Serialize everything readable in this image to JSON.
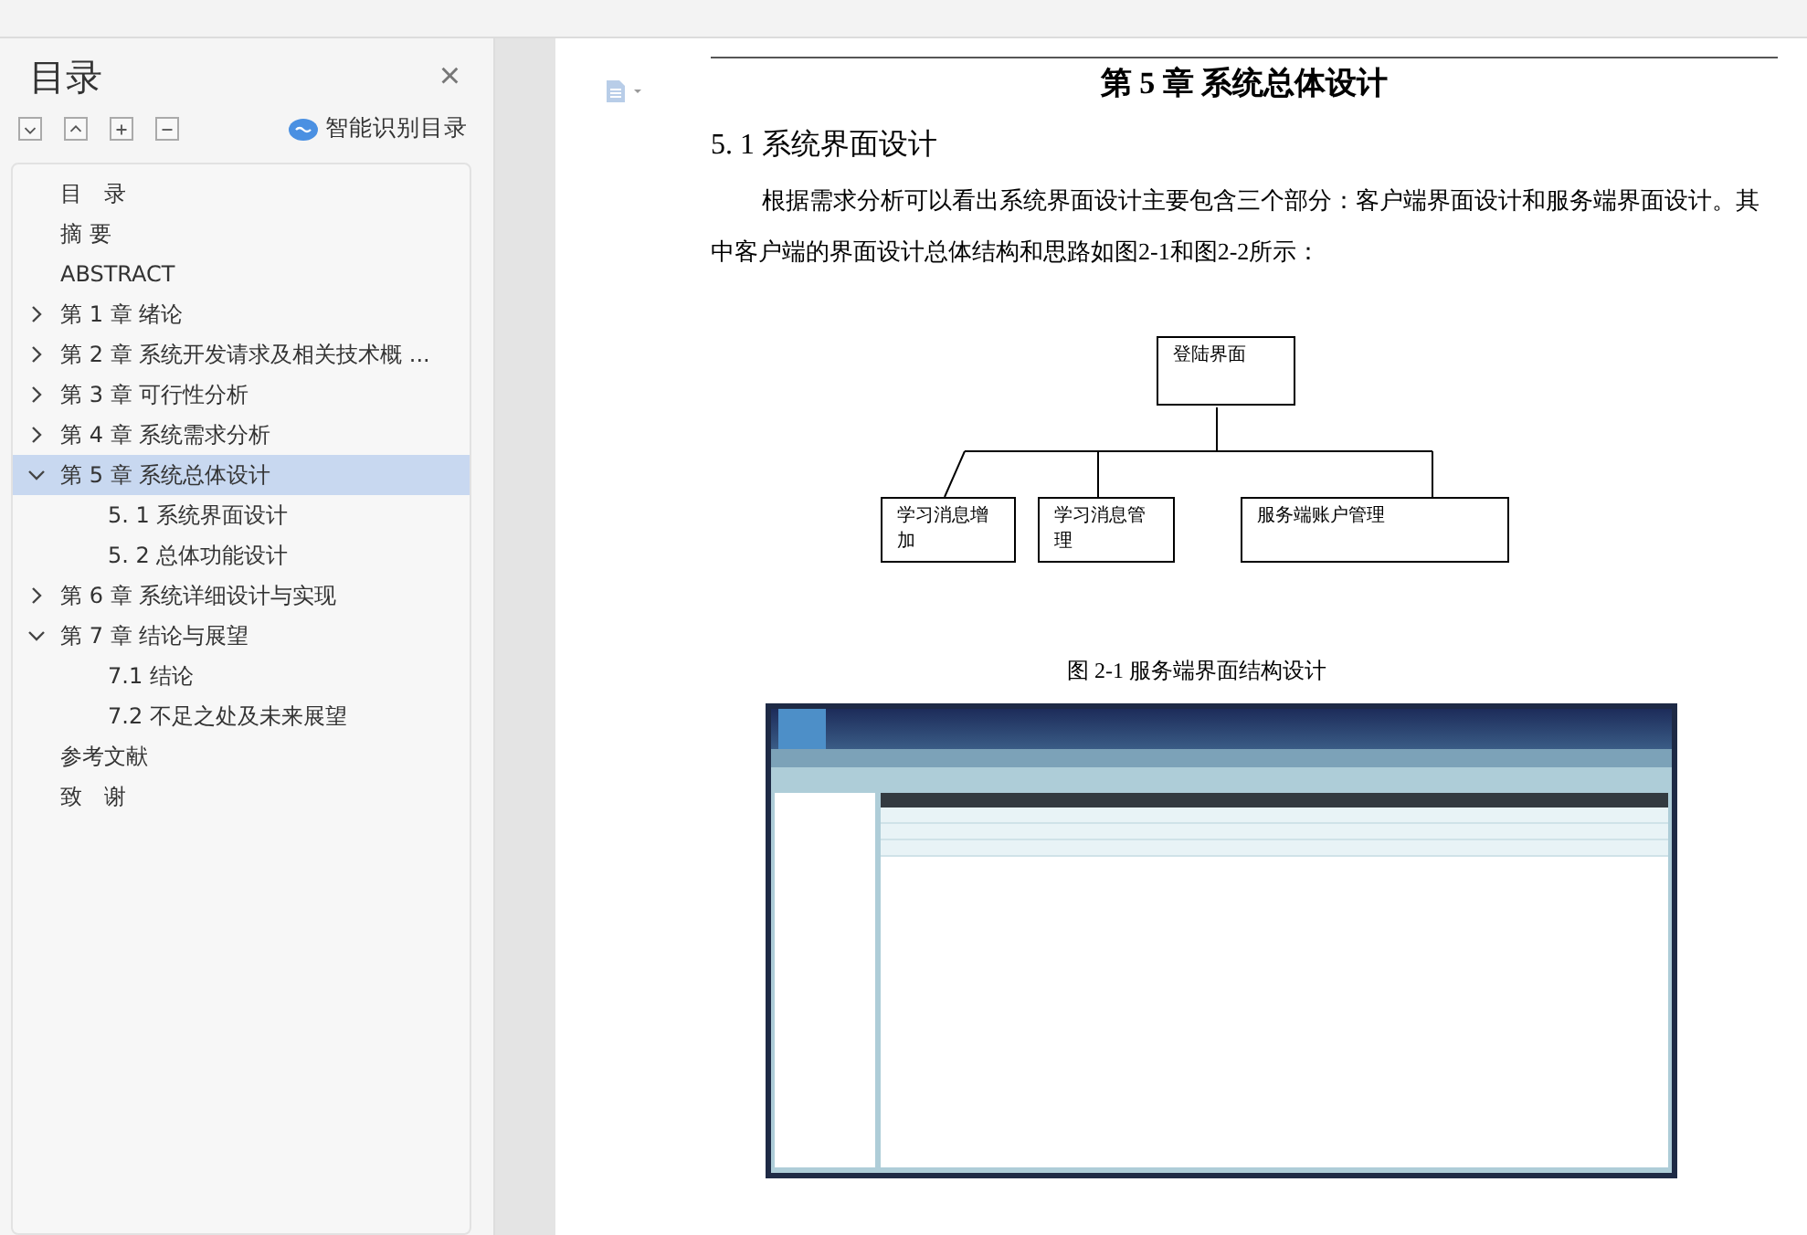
{
  "sidebar": {
    "title": "目录",
    "close": "×",
    "smart_toc": "智能识别目录",
    "items": [
      {
        "label": "目　录",
        "selected": false
      },
      {
        "label": "摘 要",
        "selected": false
      },
      {
        "label": "ABSTRACT",
        "selected": false
      },
      {
        "label": "第 1 章  绪论",
        "expanded": false,
        "selected": false
      },
      {
        "label": "第 2 章  系统开发请求及相关技术概 ...",
        "expanded": false,
        "selected": false
      },
      {
        "label": "第 3 章  可行性分析",
        "expanded": false,
        "selected": false
      },
      {
        "label": "第 4 章  系统需求分析",
        "expanded": false,
        "selected": false
      },
      {
        "label": "第 5 章  系统总体设计",
        "expanded": true,
        "selected": true,
        "children": [
          {
            "label": "5. 1  系统界面设计",
            "selected": false
          },
          {
            "label": "5. 2  总体功能设计",
            "selected": false
          }
        ]
      },
      {
        "label": "第 6 章  系统详细设计与实现",
        "expanded": false,
        "selected": false
      },
      {
        "label": "第 7 章  结论与展望",
        "expanded": true,
        "selected": false,
        "children": [
          {
            "label": "7.1  结论",
            "selected": false
          },
          {
            "label": "7.2  不足之处及未来展望",
            "selected": false
          }
        ]
      },
      {
        "label": "参考文献",
        "selected": false
      },
      {
        "label": "致　谢",
        "selected": false
      }
    ]
  },
  "document": {
    "chapter_title": "第 5 章  系统总体设计",
    "section_title": "5. 1  系统界面设计",
    "paragraph": "根据需求分析可以看出系统界面设计主要包含三个部分：客户端界面设计和服务端界面设计。其中客户端的界面设计总体结构和思路如图2-1和图2-2所示：",
    "diagram": {
      "root": "登陆界面",
      "children": [
        "学习消息增加",
        "学习消息管理",
        "服务端账户管理"
      ]
    },
    "figure_caption": "图 2-1  服务端界面结构设计"
  }
}
